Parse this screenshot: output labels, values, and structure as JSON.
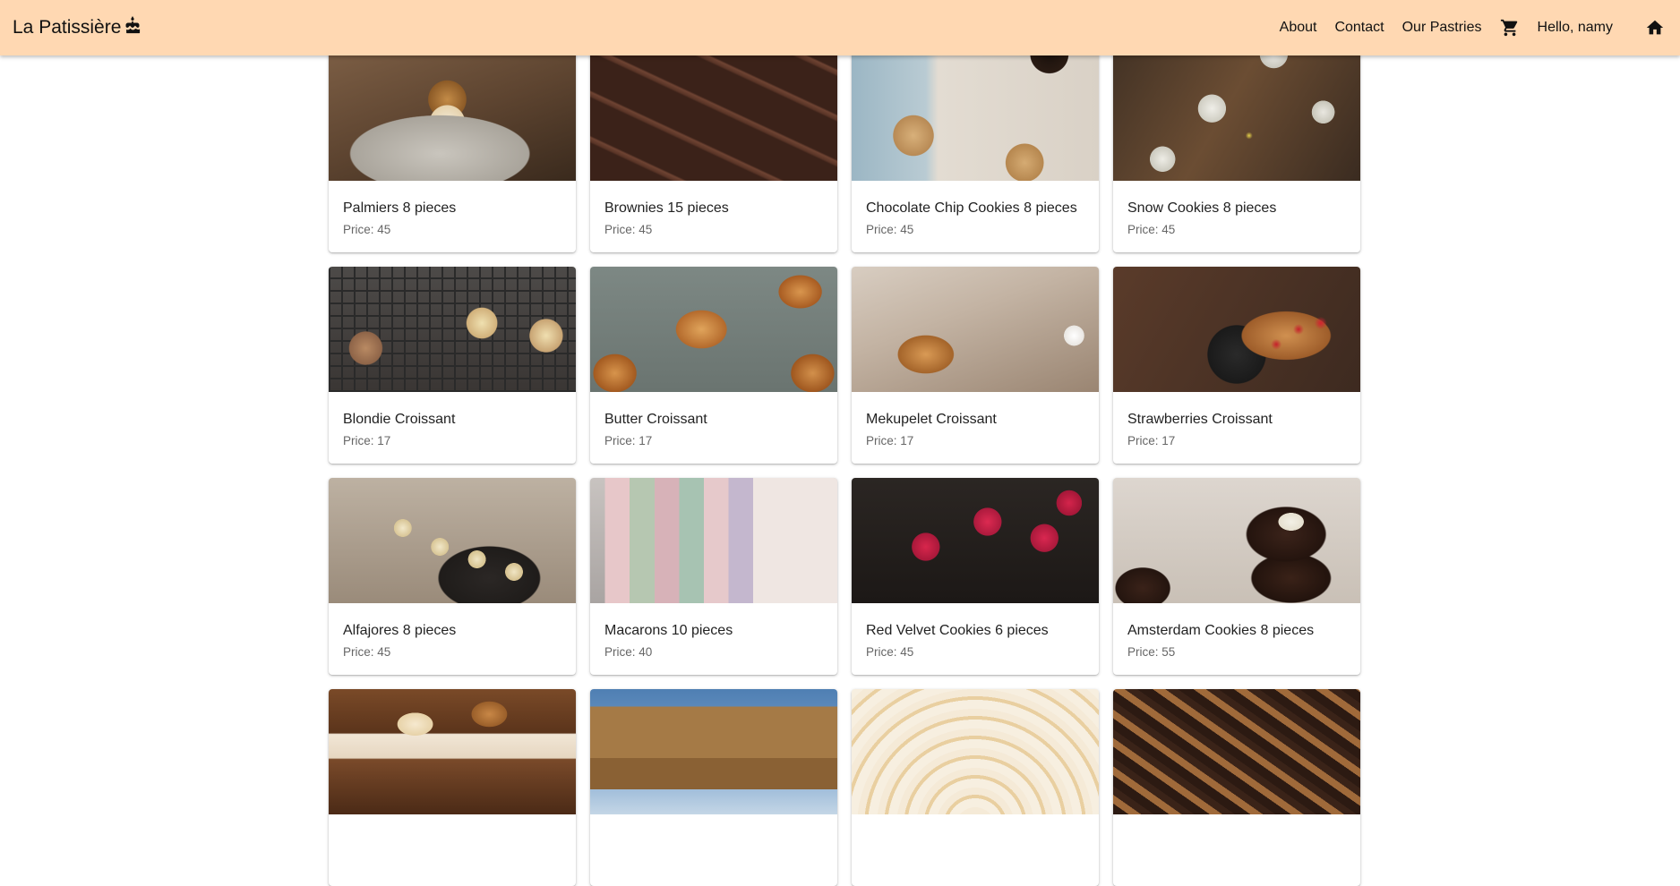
{
  "header": {
    "brand": "La Patissière",
    "brand_icon": "cake-icon",
    "nav": {
      "about": "About",
      "contact": "Contact",
      "pastries": "Our Pastries",
      "greeting": "Hello, namy"
    },
    "cart_icon": "cart-icon",
    "home_icon": "home-icon",
    "background": "#ffd8b2"
  },
  "products": [
    {
      "name": "Palmiers 8 pieces",
      "price": "Price: 45"
    },
    {
      "name": "Brownies 15 pieces",
      "price": "Price: 45"
    },
    {
      "name": "Chocolate Chip Cookies 8 pieces",
      "price": "Price: 45"
    },
    {
      "name": "Snow Cookies 8 pieces",
      "price": "Price: 45"
    },
    {
      "name": "Blondie Croissant",
      "price": "Price: 17"
    },
    {
      "name": "Butter Croissant",
      "price": "Price: 17"
    },
    {
      "name": "Mekupelet Croissant",
      "price": "Price: 17"
    },
    {
      "name": "Strawberries Croissant",
      "price": "Price: 17"
    },
    {
      "name": "Alfajores 8 pieces",
      "price": "Price: 45"
    },
    {
      "name": "Macarons 10 pieces",
      "price": "Price: 40"
    },
    {
      "name": "Red Velvet Cookies 6 pieces",
      "price": "Price: 45"
    },
    {
      "name": "Amsterdam Cookies 8 pieces",
      "price": "Price: 55"
    },
    {
      "name": "",
      "price": ""
    },
    {
      "name": "",
      "price": ""
    },
    {
      "name": "",
      "price": ""
    },
    {
      "name": "",
      "price": ""
    }
  ]
}
